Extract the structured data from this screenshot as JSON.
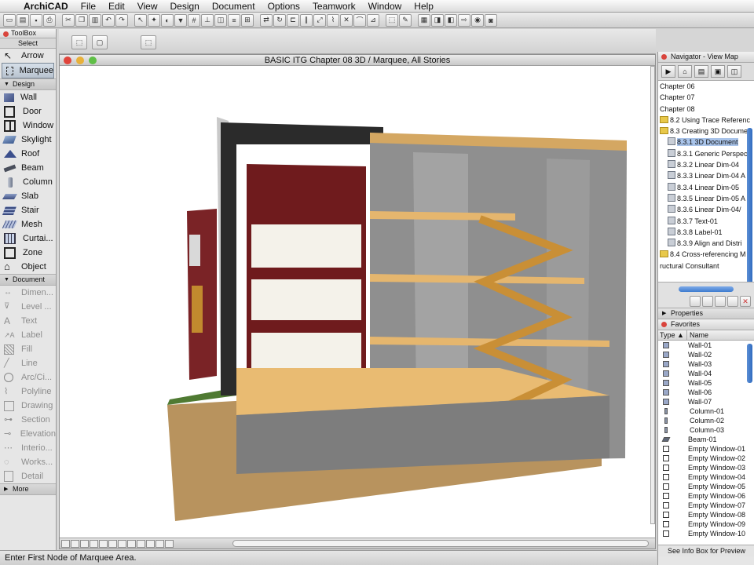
{
  "menubar": {
    "app": "ArchiCAD",
    "items": [
      "File",
      "Edit",
      "View",
      "Design",
      "Document",
      "Options",
      "Teamwork",
      "Window",
      "Help"
    ]
  },
  "toolbox": {
    "title": "ToolBox",
    "select": "Select",
    "arrow": "Arrow",
    "marquee": "Marquee",
    "design_header": "Design",
    "design_tools": [
      "Wall",
      "Door",
      "Window",
      "Skylight",
      "Roof",
      "Beam",
      "Column",
      "Slab",
      "Stair",
      "Mesh",
      "Curtai...",
      "Zone",
      "Object"
    ],
    "document_header": "Document",
    "document_tools": [
      "Dimen...",
      "Level ...",
      "Text",
      "Label",
      "Fill",
      "Line",
      "Arc/Ci...",
      "Polyline",
      "Drawing",
      "Section",
      "Elevation",
      "Interio...",
      "Works...",
      "Detail"
    ],
    "more": "More"
  },
  "window": {
    "title": "BASIC ITG Chapter 08 3D / Marquee, All Stories"
  },
  "status": "Enter First Node of Marquee Area.",
  "navigator": {
    "title": "Navigator - View Map",
    "tree": [
      {
        "label": "Chapter 06",
        "type": "root"
      },
      {
        "label": "Chapter 07",
        "type": "root"
      },
      {
        "label": "Chapter 08",
        "type": "root"
      },
      {
        "label": "8.2 Using Trace Referenc",
        "type": "folder"
      },
      {
        "label": "8.3 Creating 3D Docume",
        "type": "folder"
      },
      {
        "label": "8.3.1 3D Document",
        "type": "selected"
      },
      {
        "label": "8.3.1 Generic Perspec",
        "type": "doc"
      },
      {
        "label": "8.3.2 Linear Dim-04",
        "type": "doc"
      },
      {
        "label": "8.3.3 Linear Dim-04 A",
        "type": "doc"
      },
      {
        "label": "8.3.4 Linear Dim-05",
        "type": "doc"
      },
      {
        "label": "8.3.5 Linear Dim-05 A",
        "type": "doc"
      },
      {
        "label": "8.3.6 Linear Dim-04/",
        "type": "doc"
      },
      {
        "label": "8.3.7 Text-01",
        "type": "doc"
      },
      {
        "label": "8.3.8 Label-01",
        "type": "doc"
      },
      {
        "label": "8.3.9 Align and Distri",
        "type": "doc"
      },
      {
        "label": "8.4 Cross-referencing M",
        "type": "folder"
      },
      {
        "label": "ructural Consultant",
        "type": "root"
      }
    ],
    "properties": "Properties",
    "favorites": "Favorites",
    "fav_col_type": "Type",
    "fav_col_name": "Name",
    "fav_items": [
      {
        "name": "Wall-01",
        "kind": "wall"
      },
      {
        "name": "Wall-02",
        "kind": "wall"
      },
      {
        "name": "Wall-03",
        "kind": "wall"
      },
      {
        "name": "Wall-04",
        "kind": "wall"
      },
      {
        "name": "Wall-05",
        "kind": "wall"
      },
      {
        "name": "Wall-06",
        "kind": "wall"
      },
      {
        "name": "Wall-07",
        "kind": "wall"
      },
      {
        "name": "Column-01",
        "kind": "col"
      },
      {
        "name": "Column-02",
        "kind": "col"
      },
      {
        "name": "Column-03",
        "kind": "col"
      },
      {
        "name": "Beam-01",
        "kind": "beam"
      },
      {
        "name": "Empty Window-01",
        "kind": "win"
      },
      {
        "name": "Empty Window-02",
        "kind": "win"
      },
      {
        "name": "Empty Window-03",
        "kind": "win"
      },
      {
        "name": "Empty Window-04",
        "kind": "win"
      },
      {
        "name": "Empty Window-05",
        "kind": "win"
      },
      {
        "name": "Empty Window-06",
        "kind": "win"
      },
      {
        "name": "Empty Window-07",
        "kind": "win"
      },
      {
        "name": "Empty Window-08",
        "kind": "win"
      },
      {
        "name": "Empty Window-09",
        "kind": "win"
      },
      {
        "name": "Empty Window-10",
        "kind": "win"
      }
    ],
    "info_hint": "See Info Box for Preview"
  }
}
